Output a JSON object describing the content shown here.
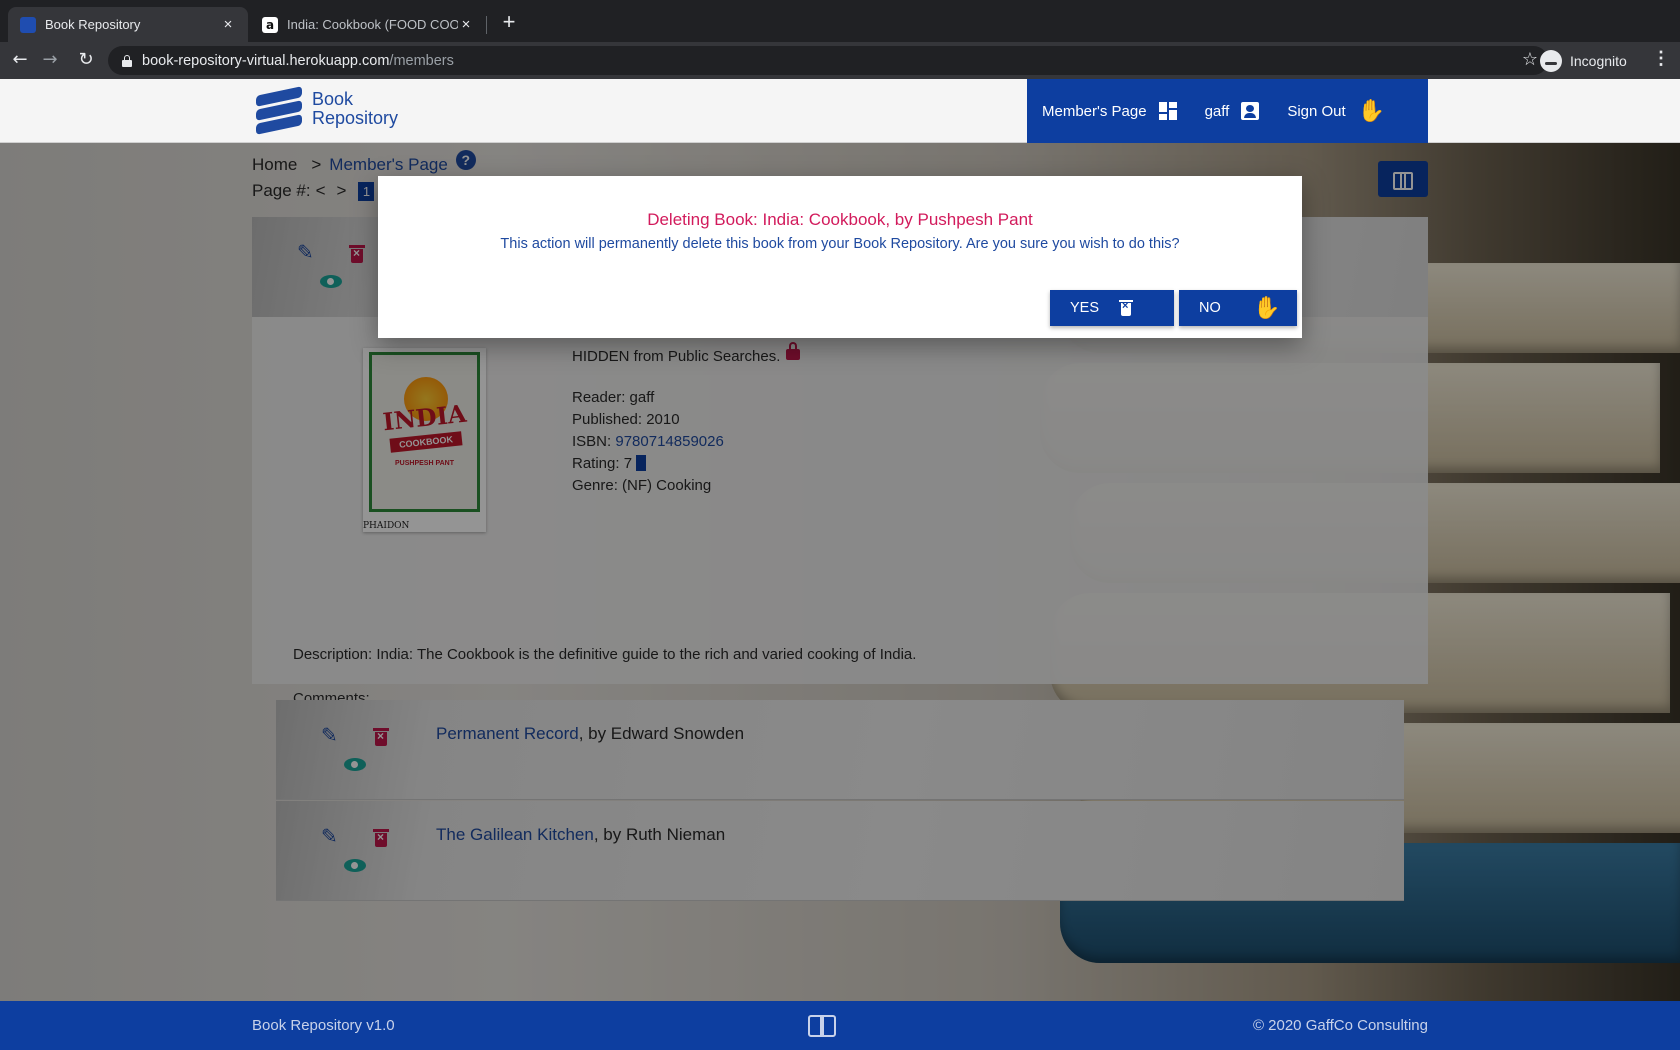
{
  "browser": {
    "tabs": [
      {
        "title": "Book Repository",
        "active": true
      },
      {
        "title": "India: Cookbook (FOOD COOK",
        "active": false
      }
    ],
    "close_glyph": "×",
    "new_tab_glyph": "+",
    "back_glyph": "←",
    "forward_glyph": "→",
    "reload_glyph": "↻",
    "url_host": "book-repository-virtual.herokuapp.com",
    "url_path": "/members",
    "star_glyph": "☆",
    "profile_label": "Incognito",
    "menu_glyph": "⋮"
  },
  "site": {
    "logo_line1": "Book",
    "logo_line2": "Repository",
    "nav": {
      "members_page": "Member's Page",
      "user": "gaff",
      "sign_out": "Sign Out",
      "hand_glyph": "✋"
    },
    "breadcrumb": {
      "home": "Home",
      "separator": ">",
      "current": "Member's Page",
      "help_glyph": "?"
    },
    "pager": {
      "label": "Page #:",
      "prev": "<",
      "next": ">",
      "current_page": "1"
    }
  },
  "book_detail": {
    "edit_glyph": "✎",
    "visibility": "HIDDEN from Public Searches.",
    "reader": "Reader: gaff",
    "published": "Published: 2010",
    "isbn_label": "ISBN:",
    "isbn": "9780714859026",
    "rating_label": "Rating: 7",
    "rating": 7,
    "genre": "Genre: (NF) Cooking",
    "description": "Description: India: The Cookbook is the definitive guide to the rich and varied cooking of India.",
    "comments": "Comments:",
    "cover": {
      "title": "INDIA",
      "subtitle": "COOKBOOK",
      "author_line": "PUSHPESH PANT",
      "publisher": "PHAIDON"
    }
  },
  "book_list": [
    {
      "title": "Permanent Record",
      "by": ", by Edward Snowden"
    },
    {
      "title": "The Galilean Kitchen",
      "by": ", by Ruth Nieman"
    }
  ],
  "modal": {
    "title": "Deleting Book: India: Cookbook, by Pushpesh Pant",
    "message": "This action will permanently delete this book from your Book Repository. Are you sure you wish to do this?",
    "yes_label": "YES",
    "no_label": "NO"
  },
  "footer": {
    "left": "Book Repository v1.0",
    "right": "© 2020 GaffCo Consulting"
  },
  "colors": {
    "brand_blue": "#0d3ea0",
    "link_blue": "#1f4aa0",
    "danger_red": "#c0184a",
    "modal_title": "#d21b5c",
    "eye_teal": "#1aa59a"
  }
}
